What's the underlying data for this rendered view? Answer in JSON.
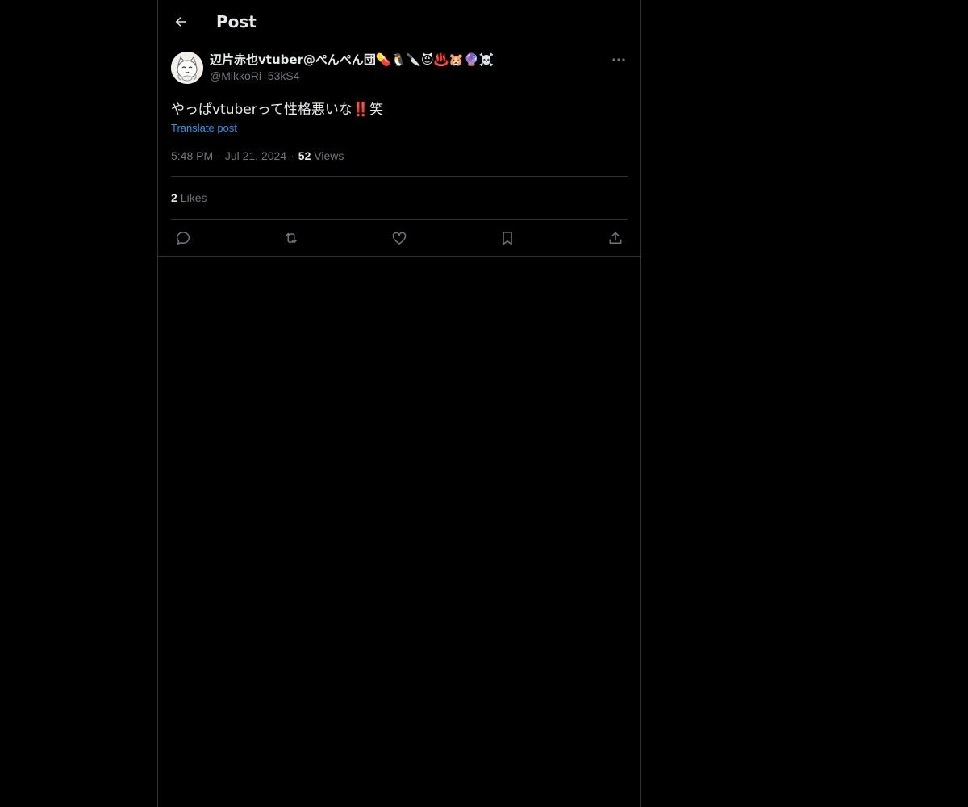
{
  "header": {
    "title": "Post",
    "back_icon": "arrow-left-icon"
  },
  "author": {
    "display_name": "辺片赤也vtuber@ぺんぺん団💊🐧🔪😈♨️🐹🔮☠️",
    "handle": "@MikkoRi_53kS4",
    "avatar": "cat-avatar"
  },
  "post": {
    "text_before": "やっぱvtuberって性格悪いな",
    "text_mark": "‼️",
    "text_after": "笑",
    "translate_label": "Translate post"
  },
  "meta": {
    "time": "5:48 PM",
    "separator": "·",
    "date": "Jul 21, 2024",
    "views_count": "52",
    "views_label": "Views"
  },
  "stats": {
    "likes_count": "2",
    "likes_label": "Likes"
  },
  "actions": [
    {
      "name": "reply",
      "icon": "reply-icon"
    },
    {
      "name": "repost",
      "icon": "repost-icon"
    },
    {
      "name": "like",
      "icon": "heart-icon"
    },
    {
      "name": "bookmark",
      "icon": "bookmark-icon"
    },
    {
      "name": "share",
      "icon": "share-icon"
    }
  ],
  "colors": {
    "background": "#000000",
    "text": "#e7e9ea",
    "muted": "#71767b",
    "accent": "#1d9bf0",
    "border": "#2f3336"
  }
}
